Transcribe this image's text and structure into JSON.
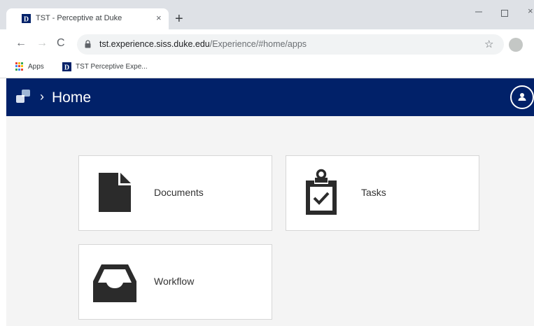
{
  "browser": {
    "tab_title": "TST - Perceptive at Duke",
    "tab_close": "×",
    "new_tab": "+",
    "url_host": "tst.experience.siss.duke.edu",
    "url_path": "/Experience/#home/apps",
    "bookmarks": [
      {
        "label": "Apps"
      },
      {
        "label": "TST Perceptive Expe..."
      }
    ],
    "nav_back_glyph": "←",
    "nav_forward_glyph": "→",
    "nav_reload_glyph": "C",
    "star_glyph": "☆",
    "close_glyph": "×",
    "favicon_letter": "D"
  },
  "app": {
    "breadcrumb_separator": "›",
    "page_title": "Home",
    "header_color": "#012169"
  },
  "tiles": [
    {
      "label": "Documents",
      "icon": "document-icon"
    },
    {
      "label": "Tasks",
      "icon": "clipboard-check-icon"
    },
    {
      "label": "Workflow",
      "icon": "inbox-tray-icon"
    }
  ],
  "colors": {
    "icon": "#2b2b2b",
    "brand_navy": "#012169"
  }
}
